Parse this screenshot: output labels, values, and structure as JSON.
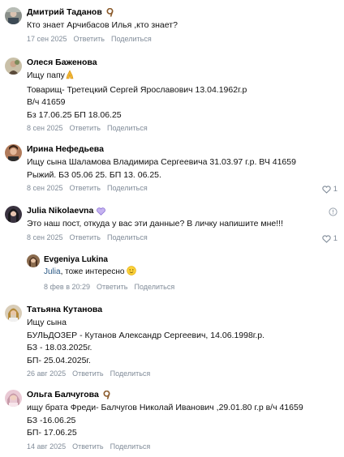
{
  "actions": {
    "reply": "Ответить",
    "share": "Поделиться"
  },
  "colors": {
    "link": "#2a5885",
    "secondary": "#818c99"
  },
  "comments": [
    {
      "author": "Дмитрий Таданов",
      "badge": "nine-badge-icon",
      "text": "Кто знает Арчибасов Илья ,кто знает?",
      "date": "17 сен 2025"
    },
    {
      "author": "Олеся Баженова",
      "text_before_emoji": "Ищу папу",
      "emoji": "praying-hands-icon",
      "text": "Товарищ- Третецкий Сергей Ярославович 13.04.1962г.р\nВ/ч 41659\nБз 17.06.25 БП 18.06.25",
      "date": "8 сен 2025"
    },
    {
      "author": "Ирина Нефедьева",
      "text": "Ищу сына Шаламова Владимира Сергеевича 31.03.97 г.р. ВЧ 41659\nРыжий. БЗ 05.06 25. БП 13. 06.25.",
      "date": "8 сен 2025",
      "likes": "1"
    },
    {
      "author": "Julia Nikolaevna",
      "badge": "purple-heart-icon",
      "text": "Это наш пост, откуда у вас эти данные? В личку напишите мне!!!",
      "date": "8 сен 2025",
      "likes": "1"
    },
    {
      "author": "Evgeniya Lukina",
      "mention": "Julia",
      "text": ", тоже интересно",
      "emoji": "smile-icon",
      "date": "8 фев в 20:29"
    },
    {
      "author": "Татьяна Кутанова",
      "text": "Ищу сына\nБУЛЬДОЗЕР - Кутанов Александр Сергеевич, 14.06.1998г.р.\nБЗ - 18.03.2025г.\nБП- 25.04.2025г.",
      "date": "26 авг 2025"
    },
    {
      "author": "Ольга Балчугова",
      "badge": "nine-badge-icon",
      "text": "ищу брата Фреди- Балчугов Николай Иванович ,29.01.80 г.р в/ч 41659\nБЗ -16.06.25\nБП- 17.06.25",
      "date": "14 авг 2025"
    }
  ]
}
